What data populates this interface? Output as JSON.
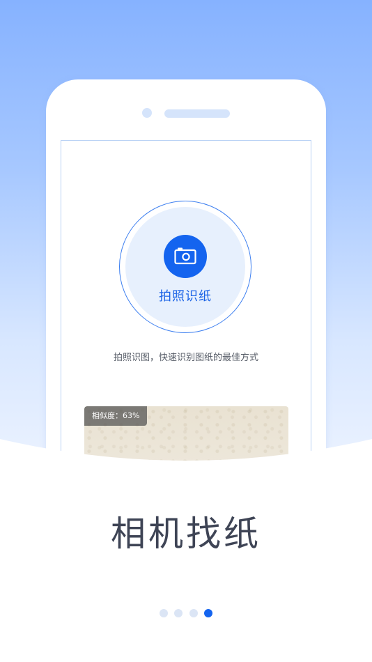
{
  "scan": {
    "button_label": "拍照识纸",
    "icon": "camera-icon"
  },
  "description": "拍照识图，快速识别图纸的最佳方式",
  "result": {
    "similarity_label": "相似度：63%"
  },
  "caption": "相机找纸",
  "pagination": {
    "total": 4,
    "current": 4
  },
  "colors": {
    "accent": "#1464ef",
    "sky_top": "#86b2ff",
    "caption_text": "#3e4455"
  }
}
